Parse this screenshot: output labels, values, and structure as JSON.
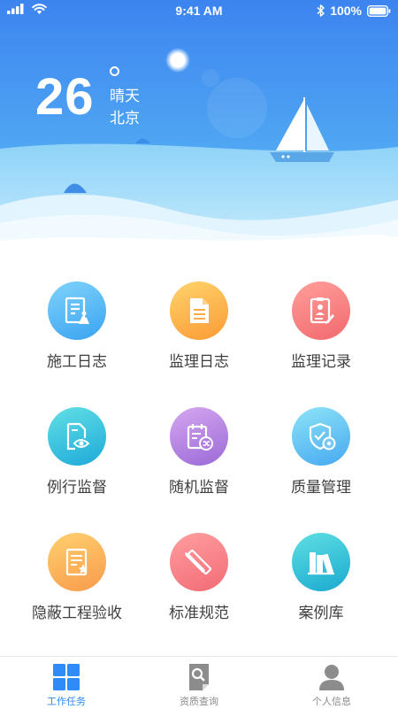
{
  "status_bar": {
    "time": "9:41 AM",
    "battery": "100%"
  },
  "weather": {
    "temperature": "26",
    "condition": "晴天",
    "city": "北京"
  },
  "grid": {
    "items": [
      {
        "label": "施工日志",
        "icon": "construction-log-icon"
      },
      {
        "label": "监理日志",
        "icon": "document-icon"
      },
      {
        "label": "监理记录",
        "icon": "record-clipboard-icon"
      },
      {
        "label": "例行监督",
        "icon": "eye-document-icon"
      },
      {
        "label": "随机监督",
        "icon": "shuffle-calendar-icon"
      },
      {
        "label": "质量管理",
        "icon": "shield-gear-icon"
      },
      {
        "label": "隐蔽工程验收",
        "icon": "inspection-document-icon"
      },
      {
        "label": "标准规范",
        "icon": "ruler-pencil-icon"
      },
      {
        "label": "案例库",
        "icon": "books-icon"
      }
    ]
  },
  "tab_bar": {
    "tabs": [
      {
        "label": "工作任务",
        "icon": "grid-icon",
        "active": true
      },
      {
        "label": "资质查询",
        "icon": "search-document-icon",
        "active": false
      },
      {
        "label": "个人信息",
        "icon": "user-icon",
        "active": false
      }
    ]
  },
  "colors": {
    "accent": "#2f8bf5",
    "sky_top": "#3d86f0",
    "sky_bottom": "#5cb8f5"
  }
}
